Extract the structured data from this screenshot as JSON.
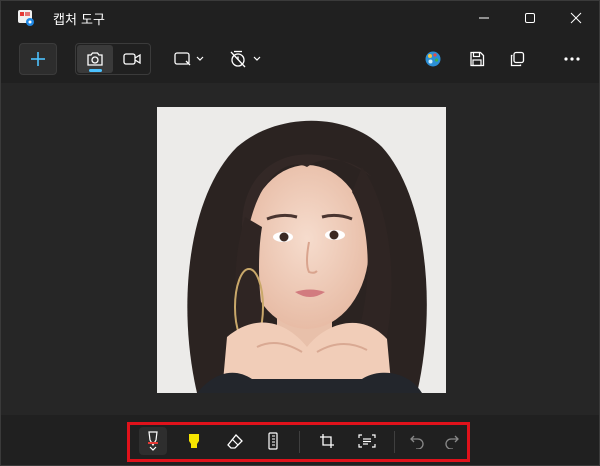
{
  "window": {
    "title": "캡처 도구"
  },
  "toolbar": {
    "new_button": "+",
    "mode": "photo"
  },
  "icons": {
    "accent": "#4cc2ff",
    "highlight_border": "#e0121b"
  },
  "image": {
    "description_alt": "캡처 이미지"
  }
}
